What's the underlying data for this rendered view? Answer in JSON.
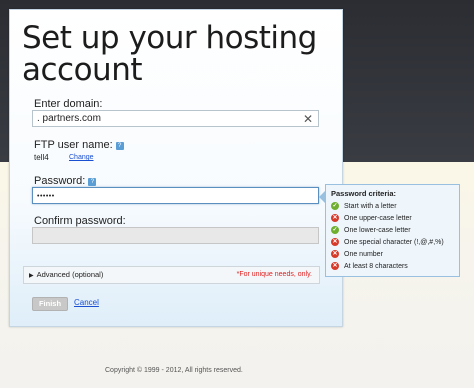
{
  "page": {
    "title": "Set up your hosting account"
  },
  "domain": {
    "label": "Enter domain:",
    "value": ".    partners.com"
  },
  "ftp": {
    "label": "FTP user name:",
    "value": "tell4",
    "change_label": "Change"
  },
  "password": {
    "label": "Password:",
    "value": "••••••"
  },
  "confirm": {
    "label": "Confirm password:",
    "value": ""
  },
  "advanced": {
    "label": "Advanced (optional)",
    "note": "*For unique needs, only."
  },
  "actions": {
    "finish_label": "Finish",
    "cancel_label": "Cancel"
  },
  "criteria": {
    "title": "Password criteria:",
    "items": [
      {
        "label": "Start with a letter",
        "status": "ok"
      },
      {
        "label": "One upper-case letter",
        "status": "bad"
      },
      {
        "label": "One lower-case letter",
        "status": "ok"
      },
      {
        "label": "One special character (!,@,#,%)",
        "status": "bad"
      },
      {
        "label": "One number",
        "status": "bad"
      },
      {
        "label": "At least 8 characters",
        "status": "bad"
      }
    ]
  },
  "footer": {
    "copyright": "Copyright © 1999 - 2012, All rights reserved."
  },
  "icons": {
    "ok": "check-icon",
    "bad": "x-icon",
    "help": "help-icon",
    "clear": "clear-icon"
  },
  "colors": {
    "link": "#1a4fd1",
    "ok": "#6fae2f",
    "bad": "#d83a2a",
    "warning_text": "#e02020"
  }
}
